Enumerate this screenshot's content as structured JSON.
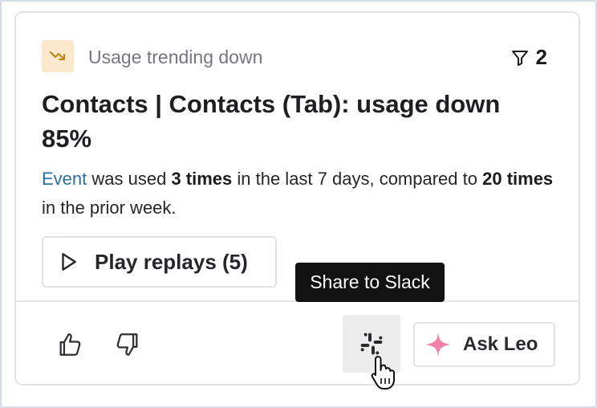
{
  "insight": {
    "trend_label": "Usage trending down",
    "filter_count": "2",
    "title": "Contacts | Contacts (Tab): usage down 85%",
    "description": {
      "event_link": "Event",
      "text_1": " was used ",
      "count_current": "3 times",
      "text_2": " in the last 7 days, compared to ",
      "count_prior": "20 times",
      "text_3": " in the prior week."
    },
    "play_button_label": "Play replays (5)"
  },
  "footer": {
    "slack_tooltip": "Share to Slack",
    "ask_leo_label": "Ask Leo"
  },
  "icons": {
    "trend": "trending-down-icon",
    "filter": "filter-icon",
    "play": "play-icon",
    "thumbs_up": "thumbs-up-icon",
    "thumbs_down": "thumbs-down-icon",
    "slack": "slack-icon",
    "sparkle": "sparkle-icon",
    "cursor": "hand-pointer-cursor"
  },
  "colors": {
    "trend_badge_bg": "#fbe8cd",
    "trend_icon": "#b8860b",
    "event_link": "#2b6fa0",
    "sparkle": "#f27fa5",
    "tooltip_bg": "#121212"
  }
}
